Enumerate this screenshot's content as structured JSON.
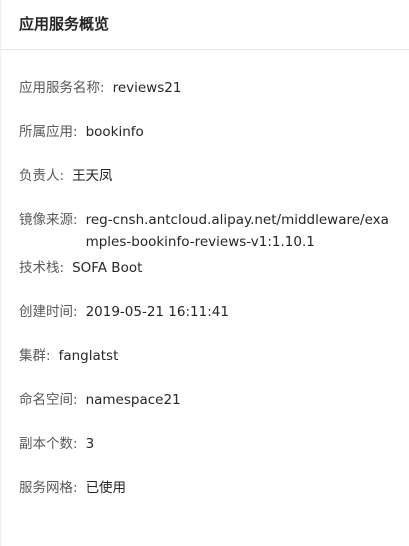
{
  "panel": {
    "title": "应用服务概览"
  },
  "fields": [
    {
      "label": "应用服务名称:",
      "value": "reviews21"
    },
    {
      "label": "所属应用:",
      "value": "bookinfo"
    },
    {
      "label": "负责人:",
      "value": "王天凤"
    },
    {
      "label": "镜像来源:",
      "value": "reg-cnsh.antcloud.alipay.net/middleware/examples-bookinfo-reviews-v1:1.10.1"
    },
    {
      "label": "技术栈:",
      "value": "SOFA Boot"
    },
    {
      "label": "创建时间:",
      "value": "2019-05-21 16:11:41"
    },
    {
      "label": "集群:",
      "value": "fanglatst"
    },
    {
      "label": "命名空间:",
      "value": "namespace21"
    },
    {
      "label": "副本个数:",
      "value": "3"
    },
    {
      "label": "服务网格:",
      "value": "已使用"
    }
  ]
}
